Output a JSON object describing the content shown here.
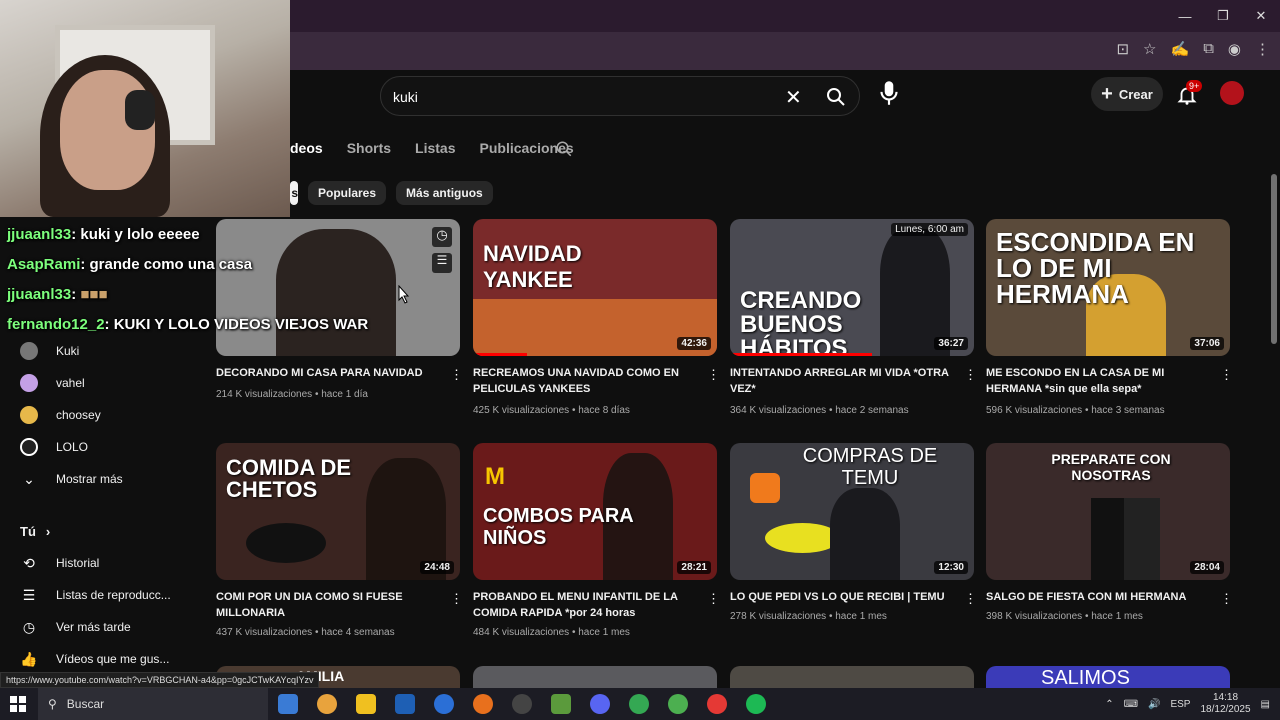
{
  "window": {
    "minimize": "—",
    "restore": "❐",
    "close": "✕"
  },
  "header": {
    "search_query": "kuki",
    "create_label": "Crear",
    "notifications_badge": "9+"
  },
  "tabs": [
    "deos",
    "Shorts",
    "Listas",
    "Publicaciones"
  ],
  "chips": [
    "s",
    "Populares",
    "Más antiguos"
  ],
  "sidebar": {
    "items": [
      {
        "label": "Kuki",
        "color": "#777777"
      },
      {
        "label": "vahel",
        "color": "#c4a0e6"
      },
      {
        "label": "choosey",
        "color": "#e6b84a"
      },
      {
        "label": "LOLO",
        "color": "#222222"
      }
    ],
    "show_more": "Mostrar más",
    "you_label": "Tú",
    "you_items": [
      "Historial",
      "Listas de reproducc...",
      "Ver más tarde",
      "Vídeos que me gus..."
    ]
  },
  "chat": [
    {
      "user": "jjuaanl33",
      "msg": ": kuki y lolo eeeee"
    },
    {
      "user": "AsapRami",
      "msg": ": grande como una casa"
    },
    {
      "user": "jjuaanl33",
      "msg": ":"
    },
    {
      "user": "fernando12_2",
      "msg": ": KUKI Y LOLO VIDEOS VIEJOS WAR"
    }
  ],
  "videos": [
    {
      "title": "DECORANDO MI CASA PARA NAVIDAD",
      "meta": "214 K visualizaciones • hace 1 día",
      "duration": "",
      "thumb_text": "",
      "bg": "#8a8a8a"
    },
    {
      "title": "RECREAMOS UNA NAVIDAD COMO EN PELICULAS YANKEES",
      "meta": "425 K visualizaciones • hace 8 días",
      "duration": "42:36",
      "thumb_text": "NAVIDAD YANKEE",
      "bg": "#7a2a2a"
    },
    {
      "title": "INTENTANDO ARREGLAR MI VIDA *OTRA VEZ*",
      "meta": "364 K visualizaciones • hace 2 semanas",
      "duration": "36:27",
      "thumb_text": "CREANDO BUENOS HÁBITOS",
      "bg": "#4a4a52",
      "badge": "Lunes, 6:00 am"
    },
    {
      "title": "ME ESCONDO EN LA CASA DE MI HERMANA *sin que ella sepa*",
      "meta": "596 K visualizaciones • hace 3 semanas",
      "duration": "37:06",
      "thumb_text": "ESCONDIDA EN LO DE MI HERMANA",
      "bg": "#5a4a3a"
    },
    {
      "title": "COMI POR UN DIA COMO SI FUESE MILLONARIA",
      "meta": "437 K visualizaciones • hace 4 semanas",
      "duration": "24:48",
      "thumb_text": "COMIDA DE CHETOS",
      "bg": "#3a2420"
    },
    {
      "title": "PROBANDO EL MENU INFANTIL DE LA COMIDA RAPIDA *por 24 horas",
      "meta": "484 K visualizaciones • hace 1 mes",
      "duration": "28:21",
      "thumb_text": "COMBOS PARA NIÑOS",
      "bg": "#6a1a1a"
    },
    {
      "title": "LO QUE PEDI VS LO QUE RECIBI | TEMU",
      "meta": "278 K visualizaciones • hace 1 mes",
      "duration": "12:30",
      "thumb_text": "COMPRAS DE TEMU",
      "bg": "#3a3a40"
    },
    {
      "title": "SALGO DE FIESTA CON MI HERMANA",
      "meta": "398 K visualizaciones • hace 1 mes",
      "duration": "28:04",
      "thumb_text": "PREPARATE CON NOSOTRAS",
      "bg": "#3a2a2a"
    }
  ],
  "next_row": [
    "AMILIA",
    "",
    "",
    "SALIMOS"
  ],
  "status_url": "https://www.youtube.com/watch?v=VRBGCHAN-a4&pp=0gcJCTwKAYcqIYzv",
  "taskbar": {
    "search_label": "Buscar",
    "lang": "ESP",
    "time": "14:18",
    "date": "18/12/2025",
    "apps": [
      "#3a7bd5",
      "#e8a33d",
      "#f0c020",
      "#1e5fb4",
      "#2b6fd6",
      "#e8701d",
      "#444444",
      "#5b9a3c",
      "#5865f2",
      "#4caf50",
      "#34a853",
      "#e53935",
      "#1db954"
    ]
  }
}
